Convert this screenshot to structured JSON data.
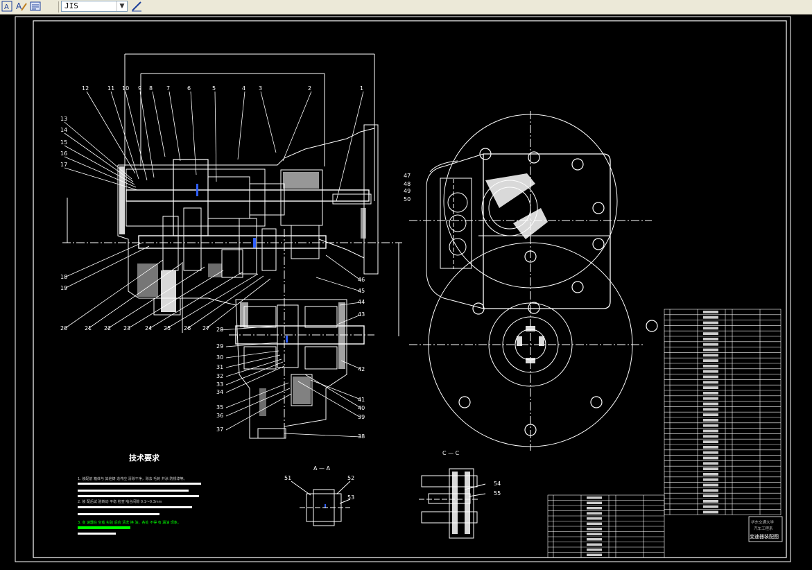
{
  "toolbar": {
    "buttons": [
      {
        "name": "text-style-icon",
        "glyph": "A"
      },
      {
        "name": "edit-text-icon",
        "glyph": "A"
      },
      {
        "name": "text-window-icon",
        "glyph": "▤"
      }
    ],
    "text_style_value": "JIS",
    "style_manager_icon": "✎"
  },
  "drawing": {
    "part_numbers_top": [
      "12",
      "11",
      "10",
      "9",
      "8",
      "7",
      "6",
      "5",
      "4",
      "3",
      "2",
      "1"
    ],
    "part_numbers_left": [
      "13",
      "14",
      "15",
      "16",
      "17",
      "18",
      "19",
      "20",
      "21",
      "22",
      "23",
      "24",
      "25",
      "26",
      "27",
      "28"
    ],
    "part_numbers_right": [
      "46",
      "45",
      "44",
      "43",
      "42",
      "41",
      "40",
      "39",
      "38"
    ],
    "part_numbers_lower": [
      "29",
      "30",
      "31",
      "32",
      "33",
      "34",
      "35",
      "36",
      "37"
    ],
    "part_numbers_side": [
      "47",
      "48",
      "49",
      "50"
    ],
    "section_aa_label": "A — A",
    "section_aa_parts": [
      "51",
      "52",
      "53"
    ],
    "section_cc_label": "C — C",
    "section_cc_parts": [
      "54",
      "55"
    ],
    "tech_req_title": "技术要求",
    "tech_req_lines": [
      "1. 装配前 箱体与 其他铸 造件应 清除干净，除去 毛刺 并涂 防锈漆等。",
      "2. 装 配后试 验转动 平稳 检查 啮合间隙 0.1～0.3mm",
      "3. 变 速器在 空载 实验 后应 清洗 换 油，各处 不得 有 漏油 现象。"
    ],
    "title_block": {
      "school": "华东交通大学",
      "dept": "汽车工程系",
      "drawing_title": "变速器装配图"
    }
  },
  "colors": {
    "line": "#ffffff",
    "hatch": "#ffffff",
    "blue_marks": "#3060ff",
    "green_note": "#00ff00",
    "yellow_marks": "#ffff00"
  }
}
